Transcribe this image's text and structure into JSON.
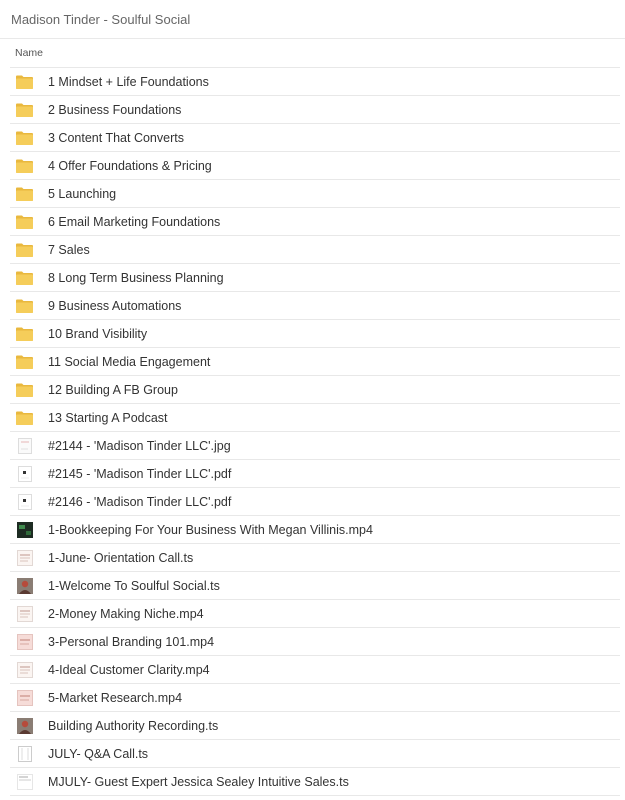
{
  "header": {
    "title": "Madison Tinder - Soulful Social"
  },
  "columns": {
    "name": "Name"
  },
  "colors": {
    "folder": "#f5cd5a",
    "folder_dark": "#e9b83e",
    "border": "#e8e8e8"
  },
  "items": [
    {
      "label": "1 Mindset + Life Foundations",
      "icon": "folder"
    },
    {
      "label": "2 Business Foundations",
      "icon": "folder"
    },
    {
      "label": "3 Content That Converts",
      "icon": "folder"
    },
    {
      "label": "4 Offer Foundations & Pricing",
      "icon": "folder"
    },
    {
      "label": "5 Launching",
      "icon": "folder"
    },
    {
      "label": "6 Email Marketing Foundations",
      "icon": "folder"
    },
    {
      "label": "7 Sales",
      "icon": "folder"
    },
    {
      "label": "8 Long Term Business Planning",
      "icon": "folder"
    },
    {
      "label": "9 Business Automations",
      "icon": "folder"
    },
    {
      "label": "10 Brand Visibility",
      "icon": "folder"
    },
    {
      "label": "11 Social Media Engagement",
      "icon": "folder"
    },
    {
      "label": "12 Building A FB Group",
      "icon": "folder"
    },
    {
      "label": "13 Starting A Podcast",
      "icon": "folder"
    },
    {
      "label": "#2144 - 'Madison Tinder LLC'.jpg",
      "icon": "image-thumb"
    },
    {
      "label": "#2145 - 'Madison Tinder LLC'.pdf",
      "icon": "pdf-thumb"
    },
    {
      "label": "#2146 - 'Madison Tinder LLC'.pdf",
      "icon": "pdf-thumb"
    },
    {
      "label": "1-Bookkeeping For Your Business With Megan Villinis.mp4",
      "icon": "video-dark-thumb"
    },
    {
      "label": "1-June- Orientation Call.ts",
      "icon": "video-slide-thumb"
    },
    {
      "label": "1-Welcome To Soulful Social.ts",
      "icon": "video-person-thumb"
    },
    {
      "label": "2-Money Making Niche.mp4",
      "icon": "video-slide-thumb"
    },
    {
      "label": "3-Personal Branding 101.mp4",
      "icon": "video-pink-thumb"
    },
    {
      "label": "4-Ideal Customer Clarity.mp4",
      "icon": "video-slide-thumb"
    },
    {
      "label": "5-Market Research.mp4",
      "icon": "video-pink-thumb"
    },
    {
      "label": "Building Authority Recording.ts",
      "icon": "video-person-thumb"
    },
    {
      "label": "JULY- Q&A Call.ts",
      "icon": "document-thumb"
    },
    {
      "label": "MJULY- Guest Expert Jessica Sealey Intuitive Sales.ts",
      "icon": "video-light-thumb"
    }
  ]
}
